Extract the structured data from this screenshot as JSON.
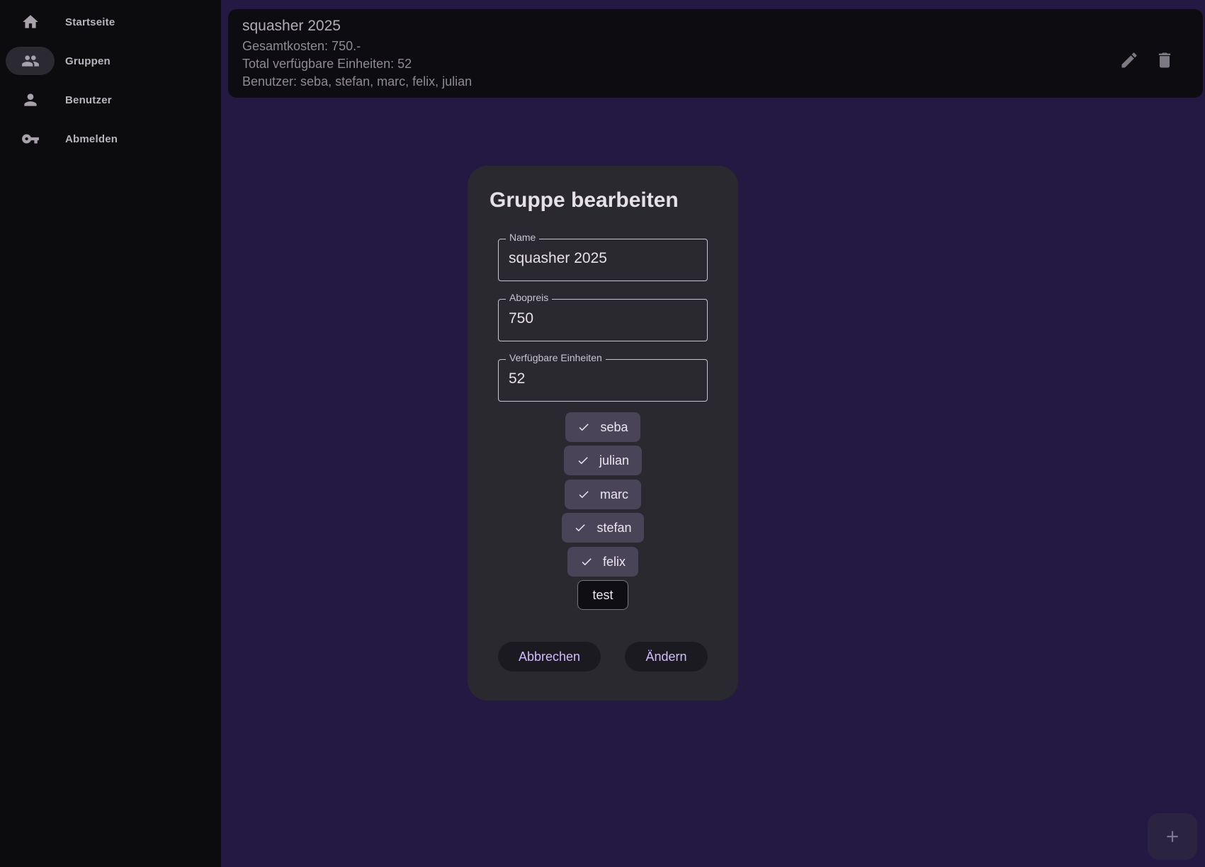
{
  "sidebar": {
    "items": [
      {
        "label": "Startseite",
        "icon": "home-icon",
        "active": false
      },
      {
        "label": "Gruppen",
        "icon": "group-icon",
        "active": true
      },
      {
        "label": "Benutzer",
        "icon": "person-icon",
        "active": false
      },
      {
        "label": "Abmelden",
        "icon": "key-icon",
        "active": false
      }
    ]
  },
  "group_card": {
    "title": "squasher 2025",
    "total_cost": "Gesamtkosten: 750.-",
    "units": "Total verfügbare Einheiten: 52",
    "users": "Benutzer: seba, stefan, marc, felix, julian",
    "actions": [
      "edit-icon",
      "delete-icon"
    ]
  },
  "dialog": {
    "title": "Gruppe bearbeiten",
    "fields": [
      {
        "label": "Name",
        "value": "squasher 2025"
      },
      {
        "label": "Abopreis",
        "value": "750"
      },
      {
        "label": "Verfügbare Einheiten",
        "value": "52"
      }
    ],
    "chips": [
      {
        "label": "seba",
        "selected": true
      },
      {
        "label": "julian",
        "selected": true
      },
      {
        "label": "marc",
        "selected": true
      },
      {
        "label": "stefan",
        "selected": true
      },
      {
        "label": "felix",
        "selected": true
      },
      {
        "label": "test",
        "selected": false
      }
    ],
    "cancel_label": "Abbrechen",
    "confirm_label": "Ändern"
  },
  "fab": {
    "icon": "plus-icon"
  },
  "colors": {
    "background": "#231942",
    "sidebar": "#0c0b0e",
    "dialog": "#2b2930",
    "accent": "#d0bcff",
    "chip_selected": "#4a4458"
  }
}
